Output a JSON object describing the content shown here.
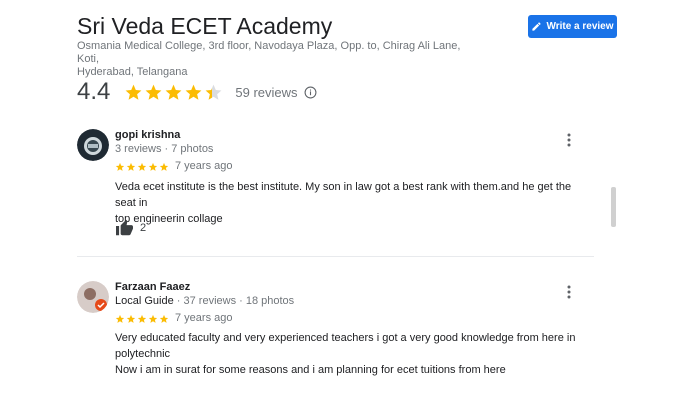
{
  "place": {
    "name": "Sri Veda ECET Academy",
    "address_line1": "Osmania Medical College, 3rd floor, Navodaya Plaza, Opp. to, Chirag Ali Lane, Koti,",
    "address_line2": "Hyderabad, Telangana"
  },
  "actions": {
    "write_review_label": "Write a review",
    "write_review_icon": "pencil-icon"
  },
  "summary": {
    "rating": "4.4",
    "rating_value": 4.4,
    "reviews_label": "59 reviews",
    "star_color": "#fbbc04",
    "empty_star_color": "#dadce0"
  },
  "reviews": [
    {
      "name": "gopi krishna",
      "meta": "3 reviews · 7 photos",
      "stars": 5,
      "time": "7 years ago",
      "text_line1": "Veda ecet institute  is the best institute. My son in law got a best rank with them.and he get the seat in",
      "text_line2": "top engineerin collage",
      "likes": "2"
    },
    {
      "name": "Farzaan Faaez",
      "badge": "Local Guide",
      "meta": " · 37 reviews · 18 photos",
      "stars": 5,
      "time": "7 years ago",
      "text_line1": "Very educated faculty and very experienced teachers i got a very good knowledge from here in",
      "text_line2": "polytechnic",
      "text_line3": "Now i am in surat for some reasons and i am planning for ecet tuitions from here"
    }
  ]
}
